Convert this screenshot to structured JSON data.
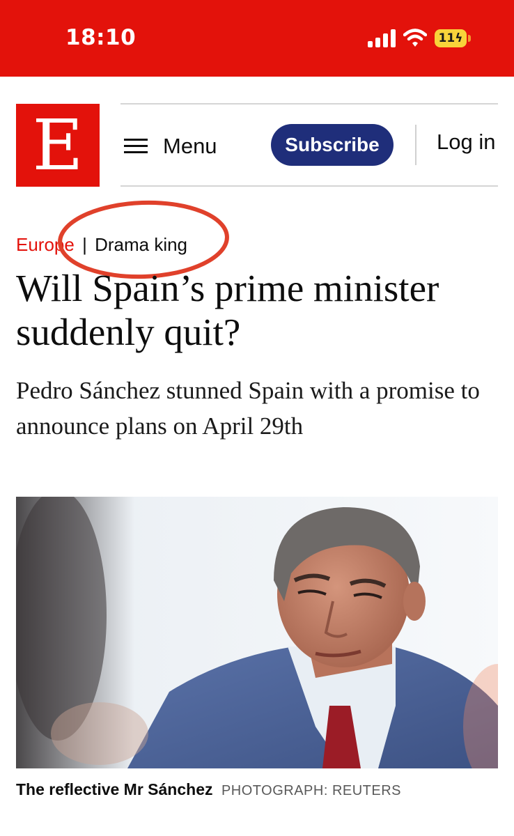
{
  "status_bar": {
    "time": "18:10",
    "battery": "11",
    "icons": [
      "signal-bars-icon",
      "wifi-icon",
      "battery-charging-icon"
    ]
  },
  "masthead": {
    "logo_letter": "E",
    "menu_label": "Menu",
    "subscribe_label": "Subscribe",
    "login_label": "Log in"
  },
  "article": {
    "section": "Europe",
    "separator": "|",
    "flytitle": "Drama king",
    "headline": "Will Spain’s prime minister suddenly quit?",
    "standfirst": "Pedro Sánchez stunned Spain with a promise to announce plans on April 29th",
    "image_caption": "The reflective Mr Sánchez",
    "image_credit": "PHOTOGRAPH: REUTERS"
  },
  "colors": {
    "brand_red": "#e3120b",
    "subscribe_blue": "#1f2e7a",
    "annotation_red": "#e0412b"
  }
}
